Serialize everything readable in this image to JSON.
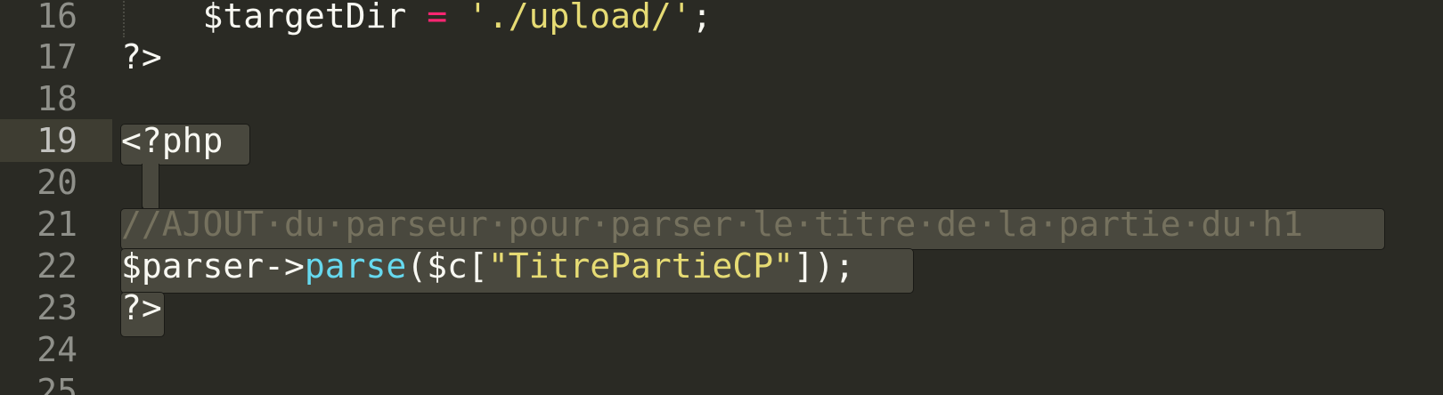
{
  "editor": {
    "line_numbers": [
      "16",
      "17",
      "18",
      "19",
      "20",
      "21",
      "22",
      "23",
      "24",
      "25"
    ],
    "current_line": "19",
    "colors": {
      "background": "#2a2a24",
      "selection": "#49483e",
      "keyword": "#f92672",
      "string": "#e6db74",
      "function": "#66d9ef",
      "comment": "#75715e"
    },
    "lines": {
      "l16": {
        "indent": "    ",
        "var": "$targetDir",
        "op": "=",
        "str": "'./upload/'",
        "end": ";"
      },
      "l17": {
        "text": "?>"
      },
      "l19": {
        "text": "<?php"
      },
      "l21": {
        "comment": "//AJOUT·du·parseur·pour·parser·le·titre·de·la·partie·du·h1"
      },
      "l22": {
        "var": "$parser->",
        "func": "parse",
        "open": "($c[",
        "str": "\"TitrePartieCP\"",
        "close": "]);"
      },
      "l23": {
        "text": "?>"
      }
    }
  }
}
